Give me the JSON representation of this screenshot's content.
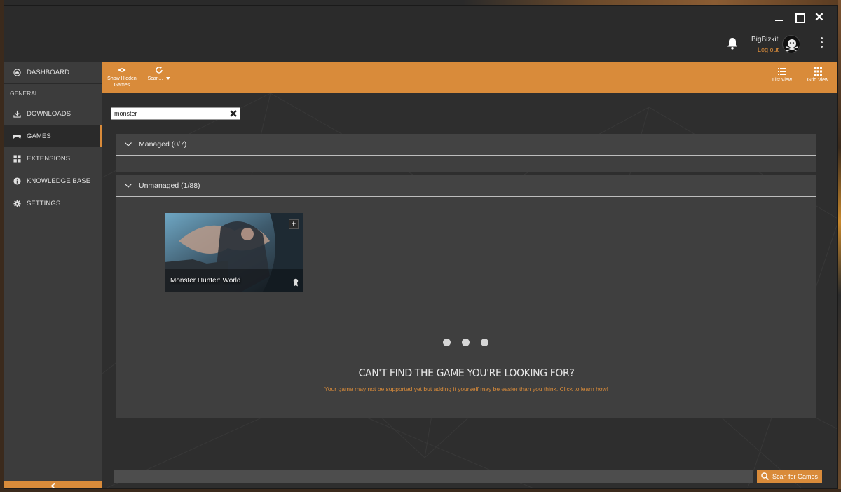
{
  "window": {
    "controls": {
      "minimize": "",
      "maximize": "",
      "close": "✕"
    }
  },
  "header": {
    "user_name": "BigBizkit",
    "logout_label": "Log out"
  },
  "sidebar": {
    "dashboard_label": "DASHBOARD",
    "section_header": "GENERAL",
    "items": [
      {
        "label": "DOWNLOADS",
        "icon": "download-icon"
      },
      {
        "label": "GAMES",
        "icon": "gamepad-icon",
        "active": true
      },
      {
        "label": "EXTENSIONS",
        "icon": "grid-icon"
      },
      {
        "label": "KNOWLEDGE BASE",
        "icon": "info-icon"
      },
      {
        "label": "SETTINGS",
        "icon": "gear-icon"
      }
    ],
    "collapse_icon": "chevron-left-icon"
  },
  "toolbar": {
    "show_hidden_label_line1": "Show Hidden",
    "show_hidden_label_line2": "Games",
    "scan_label": "Scan...",
    "list_view_label": "List View",
    "grid_view_label": "Grid View"
  },
  "search": {
    "value": "monster"
  },
  "sections": {
    "managed_title": "Managed (0/7)",
    "unmanaged_title": "Unmanaged (1/88)"
  },
  "games": [
    {
      "title": "Monster Hunter: World"
    }
  ],
  "help": {
    "title": "CAN'T FIND THE GAME YOU'RE LOOKING FOR?",
    "subtitle": "Your game may not be supported yet but adding it yourself may be easier than you think. Click to learn how!"
  },
  "footer": {
    "scan_button_label": "Scan for Games"
  },
  "colors": {
    "accent": "#d98b3a",
    "sidebar_bg": "#3c3c3c",
    "content_bg": "#2e2e2e",
    "panel_bg": "#3f3f3f"
  }
}
